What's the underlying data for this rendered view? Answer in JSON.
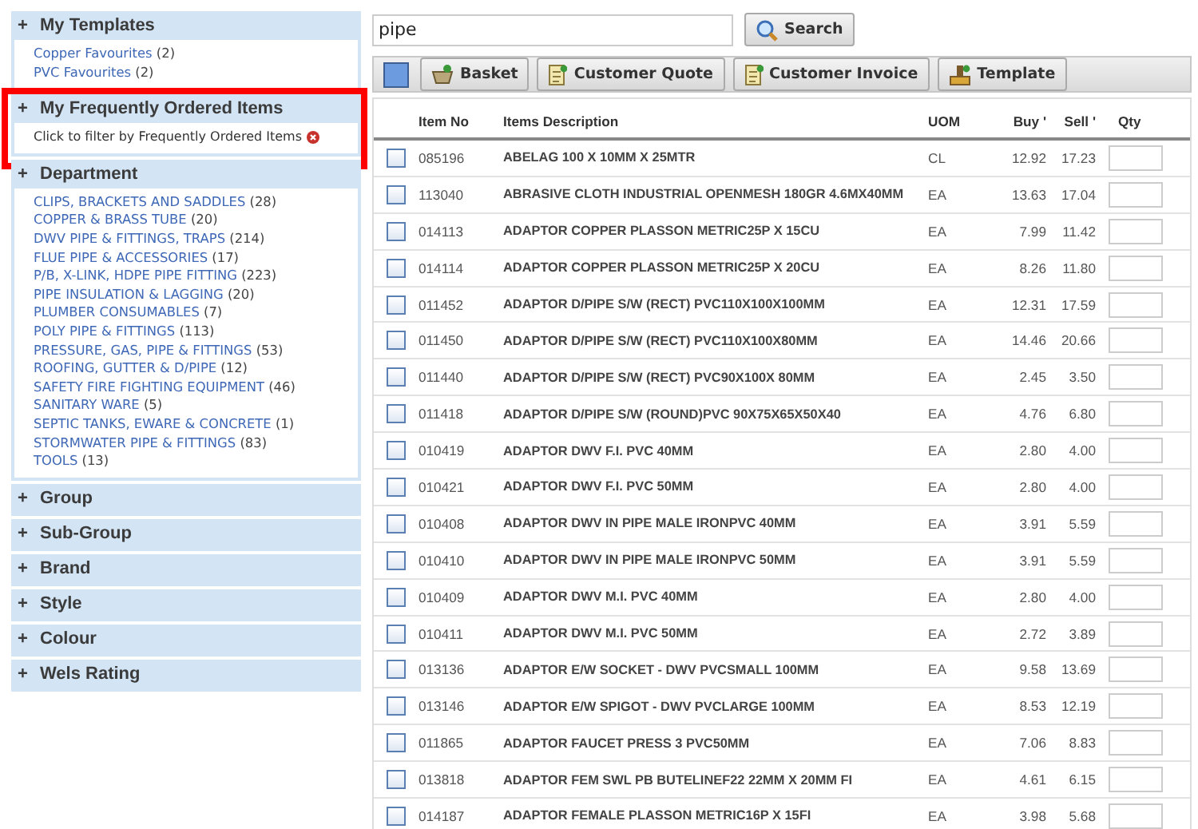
{
  "sidebar": {
    "sections": [
      {
        "toggle": "+",
        "title": "My Templates",
        "expanded": true,
        "highlighted": false,
        "links": [
          {
            "label": "Copper Favourites",
            "count": "(2)"
          },
          {
            "label": "PVC Favourites",
            "count": "(2)"
          }
        ]
      },
      {
        "toggle": "+",
        "title": "My Frequently Ordered Items",
        "expanded": true,
        "highlighted": true,
        "note": "Click to filter by Frequently Ordered Items"
      },
      {
        "toggle": "+",
        "title": "Department",
        "expanded": true,
        "highlighted": false,
        "links": [
          {
            "label": "CLIPS, BRACKETS AND SADDLES",
            "count": "(28)"
          },
          {
            "label": "COPPER & BRASS TUBE",
            "count": "(20)"
          },
          {
            "label": "DWV PIPE & FITTINGS, TRAPS",
            "count": "(214)"
          },
          {
            "label": "FLUE PIPE & ACCESSORIES",
            "count": "(17)"
          },
          {
            "label": "P/B, X-LINK, HDPE PIPE FITTING",
            "count": "(223)"
          },
          {
            "label": "PIPE INSULATION & LAGGING",
            "count": "(20)"
          },
          {
            "label": "PLUMBER CONSUMABLES",
            "count": "(7)"
          },
          {
            "label": "POLY PIPE & FITTINGS",
            "count": "(113)"
          },
          {
            "label": "PRESSURE, GAS, PIPE & FITTINGS",
            "count": "(53)"
          },
          {
            "label": "ROOFING, GUTTER & D/PIPE",
            "count": "(12)"
          },
          {
            "label": "SAFETY FIRE FIGHTING EQUIPMENT",
            "count": "(46)"
          },
          {
            "label": "SANITARY WARE",
            "count": "(5)"
          },
          {
            "label": "SEPTIC TANKS, EWARE & CONCRETE",
            "count": "(1)"
          },
          {
            "label": "STORMWATER PIPE & FITTINGS",
            "count": "(83)"
          },
          {
            "label": "TOOLS",
            "count": "(13)"
          }
        ]
      },
      {
        "toggle": "+",
        "title": "Group",
        "expanded": false,
        "highlighted": false
      },
      {
        "toggle": "+",
        "title": "Sub-Group",
        "expanded": false,
        "highlighted": false
      },
      {
        "toggle": "+",
        "title": "Brand",
        "expanded": false,
        "highlighted": false
      },
      {
        "toggle": "+",
        "title": "Style",
        "expanded": false,
        "highlighted": false
      },
      {
        "toggle": "+",
        "title": "Colour",
        "expanded": false,
        "highlighted": false
      },
      {
        "toggle": "+",
        "title": "Wels Rating",
        "expanded": false,
        "highlighted": false
      }
    ]
  },
  "search": {
    "value": "pipe",
    "button": "Search"
  },
  "toolbar": {
    "select_all": {
      "checked": false
    },
    "buttons": [
      {
        "kind": "basket",
        "label": "Basket"
      },
      {
        "kind": "document",
        "label": "Customer Quote"
      },
      {
        "kind": "document",
        "label": "Customer Invoice"
      },
      {
        "kind": "template",
        "label": "Template"
      }
    ]
  },
  "table": {
    "columns": [
      "Item No",
      "Items Description",
      "UOM",
      "Buy '",
      "Sell '",
      "Qty"
    ],
    "rows": [
      {
        "checked": false,
        "item_no": "085196",
        "description": "ABELAG 100 X 10MM X 25MTR",
        "uom": "CL",
        "buy": "12.92",
        "sell": "17.23"
      },
      {
        "checked": false,
        "item_no": "113040",
        "description": "ABRASIVE CLOTH INDUSTRIAL OPENMESH 180GR 4.6MX40MM",
        "uom": "EA",
        "buy": "13.63",
        "sell": "17.04"
      },
      {
        "checked": false,
        "item_no": "014113",
        "description": "ADAPTOR COPPER PLASSON METRIC25P X 15CU",
        "uom": "EA",
        "buy": "7.99",
        "sell": "11.42"
      },
      {
        "checked": false,
        "item_no": "014114",
        "description": "ADAPTOR COPPER PLASSON METRIC25P X 20CU",
        "uom": "EA",
        "buy": "8.26",
        "sell": "11.80"
      },
      {
        "checked": false,
        "item_no": "011452",
        "description": "ADAPTOR D/PIPE S/W (RECT) PVC110X100X100MM",
        "uom": "EA",
        "buy": "12.31",
        "sell": "17.59"
      },
      {
        "checked": false,
        "item_no": "011450",
        "description": "ADAPTOR D/PIPE S/W (RECT) PVC110X100X80MM",
        "uom": "EA",
        "buy": "14.46",
        "sell": "20.66"
      },
      {
        "checked": false,
        "item_no": "011440",
        "description": "ADAPTOR D/PIPE S/W (RECT) PVC90X100X 80MM",
        "uom": "EA",
        "buy": "2.45",
        "sell": "3.50"
      },
      {
        "checked": false,
        "item_no": "011418",
        "description": "ADAPTOR D/PIPE S/W (ROUND)PVC 90X75X65X50X40",
        "uom": "EA",
        "buy": "4.76",
        "sell": "6.80"
      },
      {
        "checked": false,
        "item_no": "010419",
        "description": "ADAPTOR DWV F.I. PVC 40MM",
        "uom": "EA",
        "buy": "2.80",
        "sell": "4.00"
      },
      {
        "checked": false,
        "item_no": "010421",
        "description": "ADAPTOR DWV F.I. PVC 50MM",
        "uom": "EA",
        "buy": "2.80",
        "sell": "4.00"
      },
      {
        "checked": false,
        "item_no": "010408",
        "description": "ADAPTOR DWV IN PIPE MALE IRONPVC 40MM",
        "uom": "EA",
        "buy": "3.91",
        "sell": "5.59"
      },
      {
        "checked": false,
        "item_no": "010410",
        "description": "ADAPTOR DWV IN PIPE MALE IRONPVC 50MM",
        "uom": "EA",
        "buy": "3.91",
        "sell": "5.59"
      },
      {
        "checked": false,
        "item_no": "010409",
        "description": "ADAPTOR DWV M.I. PVC 40MM",
        "uom": "EA",
        "buy": "2.80",
        "sell": "4.00"
      },
      {
        "checked": false,
        "item_no": "010411",
        "description": "ADAPTOR DWV M.I. PVC 50MM",
        "uom": "EA",
        "buy": "2.72",
        "sell": "3.89"
      },
      {
        "checked": false,
        "item_no": "013136",
        "description": "ADAPTOR E/W SOCKET - DWV PVCSMALL 100MM",
        "uom": "EA",
        "buy": "9.58",
        "sell": "13.69"
      },
      {
        "checked": false,
        "item_no": "013146",
        "description": "ADAPTOR E/W SPIGOT - DWV PVCLARGE 100MM",
        "uom": "EA",
        "buy": "8.53",
        "sell": "12.19"
      },
      {
        "checked": false,
        "item_no": "011865",
        "description": "ADAPTOR FAUCET PRESS 3 PVC50MM",
        "uom": "EA",
        "buy": "7.06",
        "sell": "8.83"
      },
      {
        "checked": false,
        "item_no": "013818",
        "description": "ADAPTOR FEM SWL PB BUTELINEF22 22MM X 20MM FI",
        "uom": "EA",
        "buy": "4.61",
        "sell": "6.15"
      },
      {
        "checked": false,
        "item_no": "014187",
        "description": "ADAPTOR FEMALE PLASSON METRIC16P X 15FI",
        "uom": "EA",
        "buy": "3.98",
        "sell": "5.68"
      }
    ]
  }
}
